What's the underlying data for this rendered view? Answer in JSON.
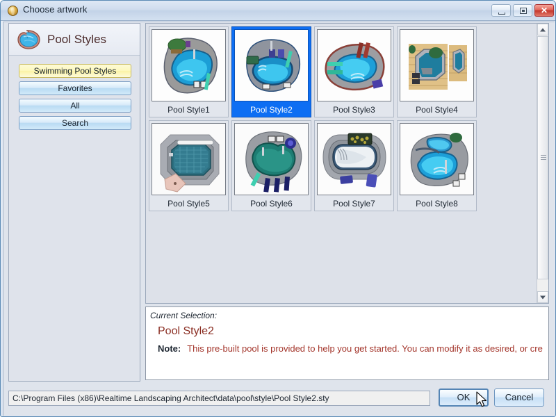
{
  "window": {
    "title": "Choose artwork",
    "icon": "app-globe-icon",
    "controls": {
      "minimize": "minimize-icon",
      "maximize": "maximize-icon",
      "close": "✕"
    }
  },
  "sidebar": {
    "logo_icon": "pool-shape-icon",
    "title": "Pool Styles",
    "buttons": [
      {
        "label": "Swimming Pool Styles",
        "active": true
      },
      {
        "label": "Favorites",
        "active": false
      },
      {
        "label": "All",
        "active": false
      },
      {
        "label": "Search",
        "active": false
      }
    ]
  },
  "gallery": {
    "scrollbar": {
      "up_icon": "scroll-up-arrow-icon",
      "down_icon": "scroll-down-arrow-icon",
      "grip_icon": "scroll-thumb-grip-icon"
    },
    "items": [
      {
        "label": "Pool Style1",
        "selected": false
      },
      {
        "label": "Pool Style2",
        "selected": true
      },
      {
        "label": "Pool Style3",
        "selected": false
      },
      {
        "label": "Pool Style4",
        "selected": false
      },
      {
        "label": "Pool Style5",
        "selected": false
      },
      {
        "label": "Pool Style6",
        "selected": false
      },
      {
        "label": "Pool Style7",
        "selected": false
      },
      {
        "label": "Pool Style8",
        "selected": false
      }
    ]
  },
  "selection": {
    "caption": "Current Selection:",
    "name": "Pool Style2",
    "note_label": "Note:",
    "note_text": "This pre-built pool is provided to help you get started. You can modify it as desired, or cre"
  },
  "footer": {
    "path": "C:\\Program Files (x86)\\Realtime Landscaping Architect\\data\\pool\\style\\Pool Style2.sty",
    "ok_label": "OK",
    "cancel_label": "Cancel"
  },
  "colors": {
    "selection_blue": "#0d6ef3",
    "active_nav_yellow": "#fdf8bd",
    "note_red": "#a3342a",
    "title_maroon": "#8a2d22"
  }
}
